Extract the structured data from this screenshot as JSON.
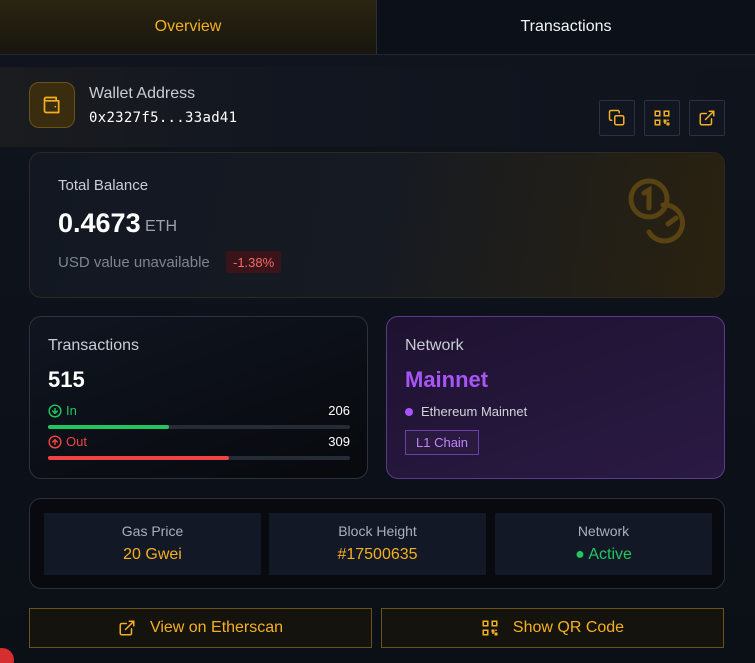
{
  "tabs": [
    {
      "label": "Overview",
      "active": true
    },
    {
      "label": "Transactions",
      "active": false
    }
  ],
  "wallet": {
    "label": "Wallet Address",
    "address": "0x2327f5...33ad41",
    "icons": [
      "wallet-icon",
      "copy-icon",
      "qr-code-icon",
      "external-link-icon"
    ]
  },
  "balance": {
    "label": "Total Balance",
    "value": "0.4673",
    "unit": "ETH",
    "usd": "USD value unavailable",
    "change": "-1.38%"
  },
  "transactions": {
    "label": "Transactions",
    "total": "515",
    "in_label": "In",
    "in_value": "206",
    "in_fraction": 0.4,
    "out_label": "Out",
    "out_value": "309",
    "out_fraction": 0.6
  },
  "network": {
    "label": "Network",
    "name": "Mainnet",
    "chain": "Ethereum Mainnet",
    "badge": "L1 Chain"
  },
  "stats": [
    {
      "label": "Gas Price",
      "value": "20 Gwei"
    },
    {
      "label": "Block Height",
      "value": "#17500635"
    },
    {
      "label": "Network",
      "value": "● Active"
    }
  ],
  "actions": {
    "etherscan": "View on Etherscan",
    "qr": "Show QR Code"
  },
  "colors": {
    "accent": "#f5b01f",
    "purple": "#a855f7",
    "green": "#22c55e",
    "red": "#ef4444"
  }
}
